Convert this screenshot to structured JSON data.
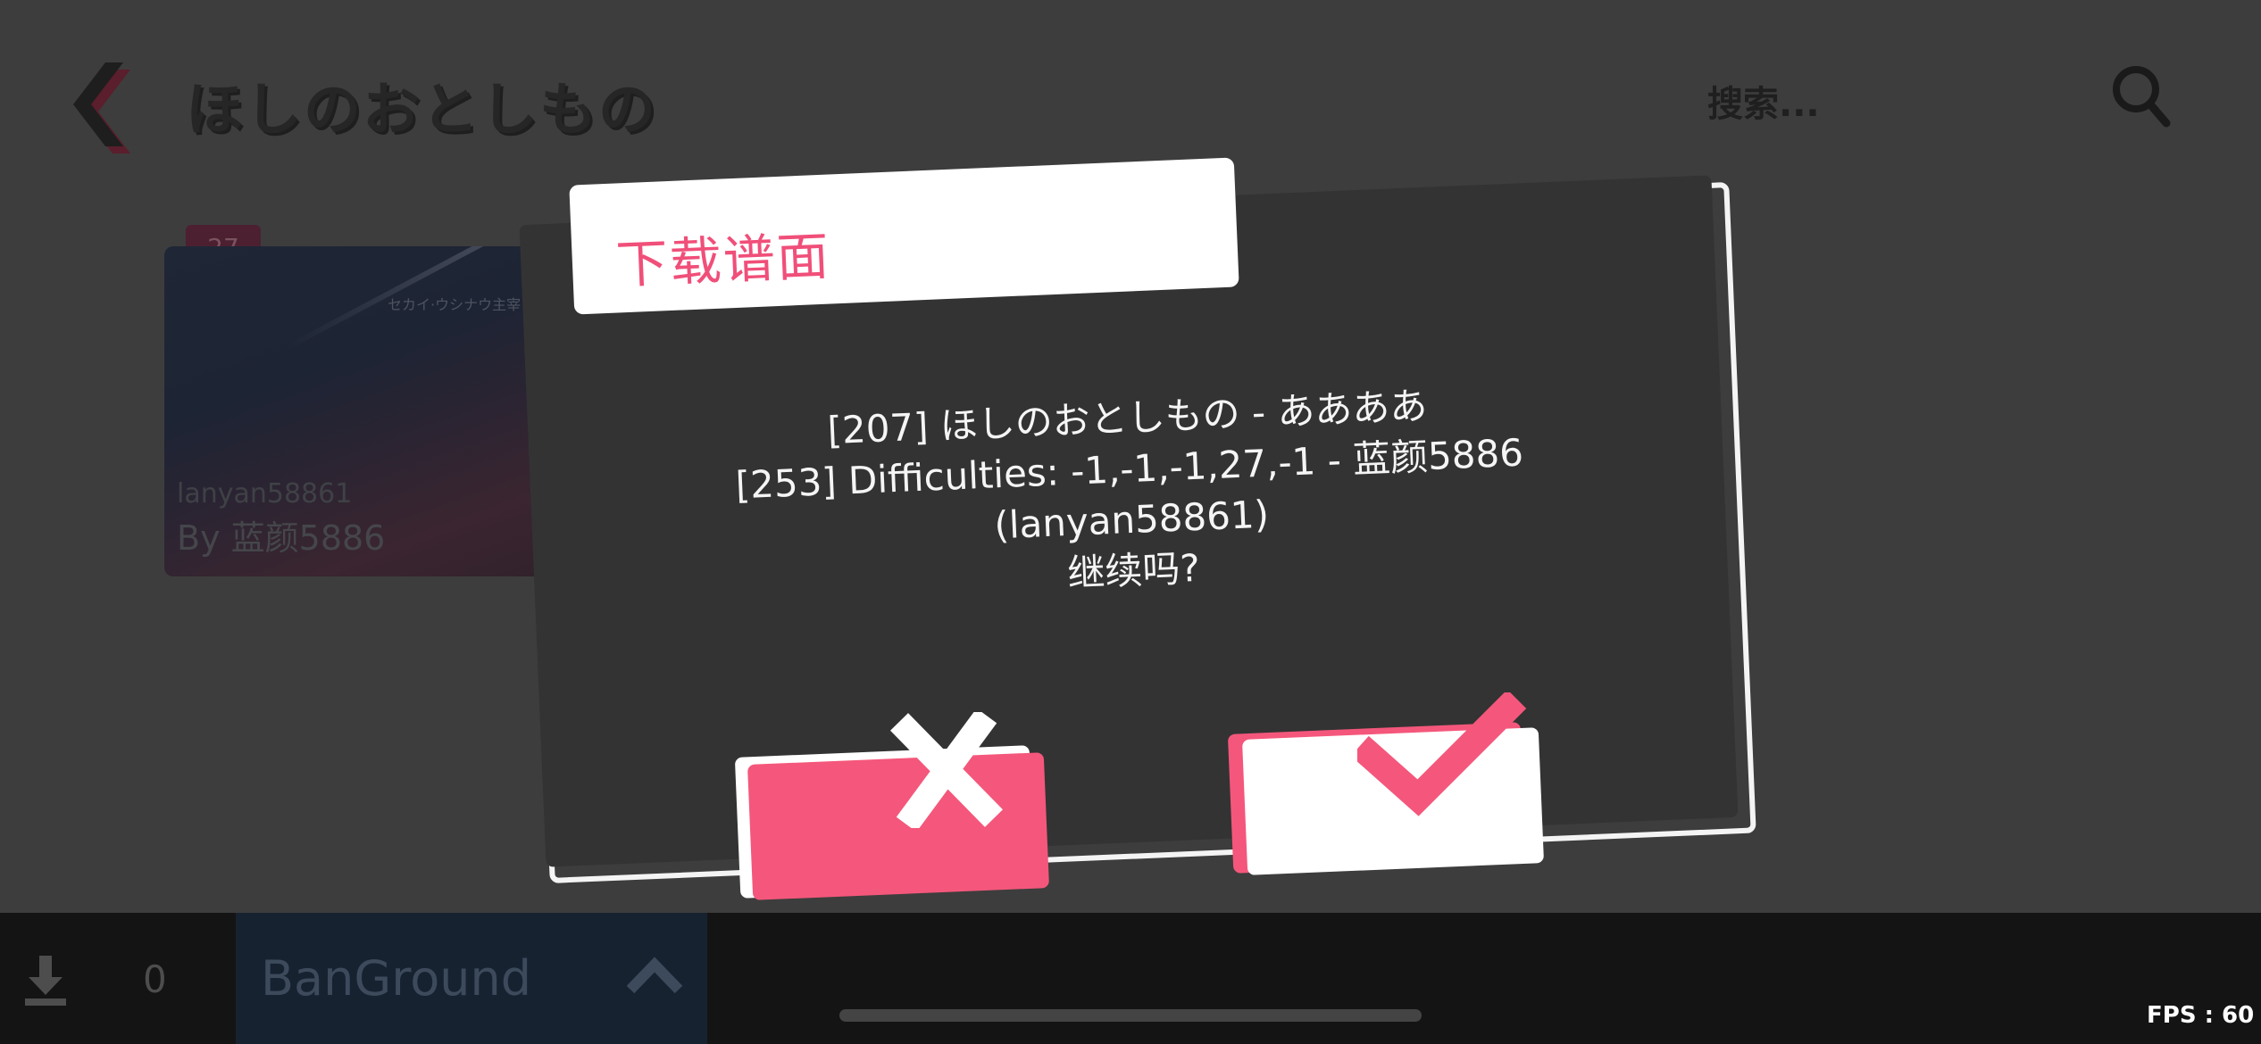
{
  "header": {
    "title": "ほしのおとしもの",
    "search_placeholder": "搜索...",
    "back_icon": "back-chevron-icon",
    "search_icon": "search-icon"
  },
  "card": {
    "badge": "27",
    "cover_text": "セカイ·ウシナウ主宰",
    "charter": "lanyan58861",
    "author": "By 蓝颜5886"
  },
  "dialog": {
    "title": "下载谱面",
    "lines": [
      "[207] ほしのおとしもの - ああああ",
      "[253] Difficulties: -1,-1,-1,27,-1 - 蓝颜5886",
      "(lanyan58861)",
      "继续吗?"
    ],
    "cancel_icon": "close-icon",
    "confirm_icon": "check-icon"
  },
  "bottom_bar": {
    "download_icon": "download-icon",
    "download_count": "0",
    "server": "BanGround",
    "server_icon": "chevron-up-icon",
    "fps": "FPS : 60"
  },
  "colors": {
    "accent": "#f4577b",
    "dialog_bg": "#333333",
    "page_bg": "#3d3d3d",
    "bar_bg": "#141414"
  }
}
